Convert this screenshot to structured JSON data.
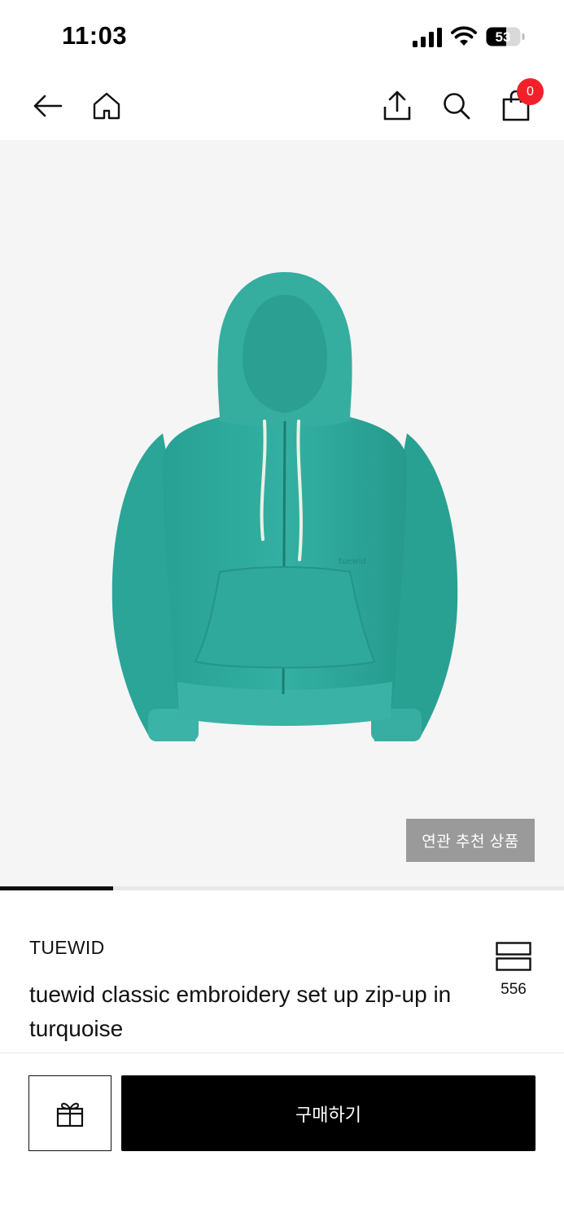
{
  "status_bar": {
    "time": "11:03",
    "battery_level": "53"
  },
  "nav": {
    "back_icon": "arrow-left-icon",
    "home_icon": "home-icon",
    "share_icon": "share-icon",
    "search_icon": "search-icon",
    "cart_icon": "shopping-bag-icon",
    "cart_count": "0"
  },
  "hero": {
    "related_label": "연관 추천 상품",
    "image_progress": 0.2
  },
  "product": {
    "brand": "TUEWID",
    "title": "tuewid classic embroidery set up zip-up in turquoise",
    "save_icon": "stacked-boxes-icon",
    "save_count": "556"
  },
  "bottom_bar": {
    "gift_icon": "gift-icon",
    "buy_label": "구매하기"
  },
  "colors": {
    "accent_badge": "#f2202a",
    "buy_button": "#000000",
    "related_button": "#9a9a9a",
    "hero_background": "#f5f5f5",
    "product_color": "#2ea79a"
  }
}
